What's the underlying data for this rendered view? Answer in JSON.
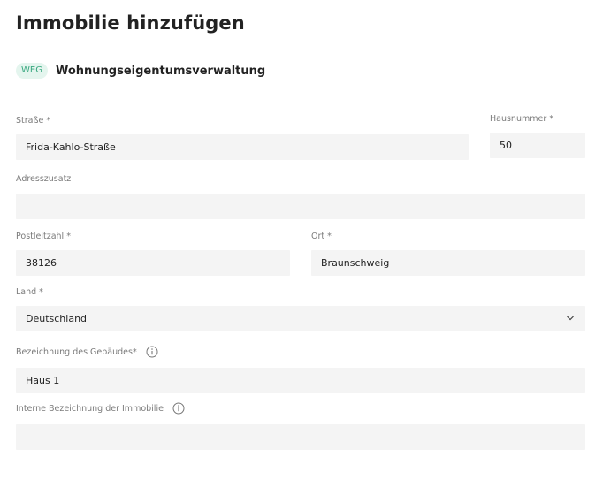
{
  "page": {
    "title": "Immobilie hinzufügen",
    "type_badge": "WEG",
    "type_label": "Wohnungseigentumsverwaltung"
  },
  "form": {
    "street": {
      "label": "Straße *",
      "value": "Frida-Kahlo-Straße"
    },
    "house_number": {
      "label": "Hausnummer *",
      "value": "50"
    },
    "address_extra": {
      "label": "Adresszusatz",
      "value": ""
    },
    "postal_code": {
      "label": "Postleitzahl *",
      "value": "38126"
    },
    "city": {
      "label": "Ort *",
      "value": "Braunschweig"
    },
    "country": {
      "label": "Land *",
      "value": "Deutschland",
      "icon": "chevron-down-icon"
    },
    "building_name": {
      "label": "Bezeichnung des Gebäudes*",
      "value": "Haus 1",
      "icon": "info-icon"
    },
    "internal_name": {
      "label": "Interne Bezeichnung der Immobilie",
      "value": "",
      "icon": "info-icon"
    }
  },
  "colors": {
    "badge_bg": "#e4f5ee",
    "badge_text": "#3aa880",
    "field_bg": "#f4f4f4",
    "label_text": "#7a7a7a"
  }
}
